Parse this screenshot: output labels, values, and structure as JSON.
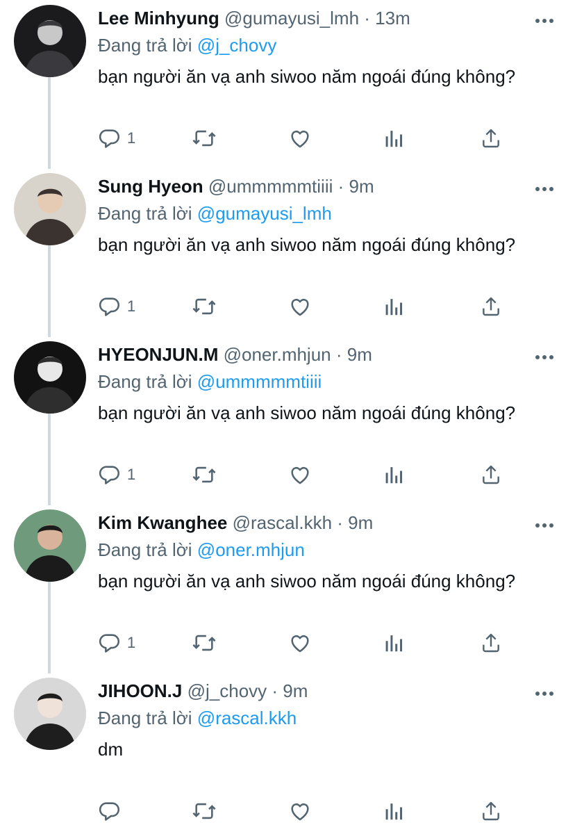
{
  "tweets": [
    {
      "name": "Lee Minhyung",
      "handle": "@gumayusi_lmh",
      "time": "13m",
      "reply_prefix": "Đang trả lời",
      "reply_to": "@j_chovy",
      "text": "bạn người ăn vạ anh siwoo năm ngoái đúng không?",
      "reply_count": "1",
      "avatar_colors": [
        "#1b1b1d",
        "#3a3a3e",
        "#c8c8c8"
      ]
    },
    {
      "name": "Sung Hyeon",
      "handle": "@ummmmmtiiii",
      "time": "9m",
      "reply_prefix": "Đang trả lời",
      "reply_to": "@gumayusi_lmh",
      "text": "bạn người ăn vạ anh siwoo năm ngoái đúng không?",
      "reply_count": "1",
      "avatar_colors": [
        "#d9d4cb",
        "#3b3330",
        "#e6cbb4"
      ]
    },
    {
      "name": "HYEONJUN.M",
      "handle": "@oner.mhjun",
      "time": "9m",
      "reply_prefix": "Đang trả lời",
      "reply_to": "@ummmmmtiiii",
      "text": "bạn người ăn vạ anh siwoo năm ngoái đúng không?",
      "reply_count": "1",
      "avatar_colors": [
        "#121212",
        "#2e2e2e",
        "#e8e8e8"
      ]
    },
    {
      "name": "Kim Kwanghee",
      "handle": "@rascal.kkh",
      "time": "9m",
      "reply_prefix": "Đang trả lời",
      "reply_to": "@oner.mhjun",
      "text": "bạn người ăn vạ anh siwoo năm ngoái đúng không?",
      "reply_count": "1",
      "avatar_colors": [
        "#6f9a7c",
        "#1b1b1b",
        "#d9b39c"
      ]
    },
    {
      "name": "JIHOON.J",
      "handle": "@j_chovy",
      "time": "9m",
      "reply_prefix": "Đang trả lời",
      "reply_to": "@rascal.kkh",
      "text": "dm",
      "reply_count": "",
      "avatar_colors": [
        "#d8d8d8",
        "#1e1e1e",
        "#efe2d8"
      ]
    }
  ],
  "colors": {
    "text": "#0f1419",
    "secondary": "#536471",
    "accent": "#1d9bf0",
    "thread_line": "#cfd9de"
  },
  "icons": [
    "more-icon",
    "reply-icon",
    "retweet-icon",
    "like-icon",
    "views-icon",
    "share-icon"
  ]
}
